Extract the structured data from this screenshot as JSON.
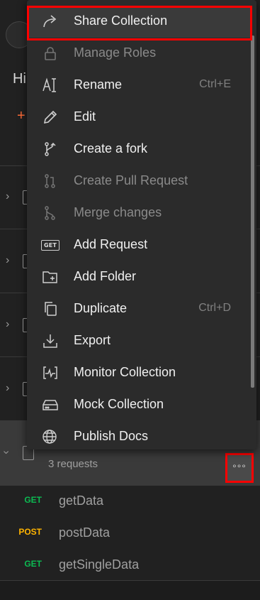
{
  "menu": {
    "items": [
      {
        "label": "Share Collection",
        "icon": "share-icon",
        "shortcut": "",
        "disabled": false,
        "highlighted": true
      },
      {
        "label": "Manage Roles",
        "icon": "lock-icon",
        "shortcut": "",
        "disabled": true
      },
      {
        "label": "Rename",
        "icon": "rename-icon",
        "shortcut": "Ctrl+E",
        "disabled": false
      },
      {
        "label": "Edit",
        "icon": "pencil-icon",
        "shortcut": "",
        "disabled": false
      },
      {
        "label": "Create a fork",
        "icon": "fork-icon",
        "shortcut": "",
        "disabled": false
      },
      {
        "label": "Create Pull Request",
        "icon": "pull-request-icon",
        "shortcut": "",
        "disabled": true
      },
      {
        "label": "Merge changes",
        "icon": "merge-icon",
        "shortcut": "",
        "disabled": true
      },
      {
        "label": "Add Request",
        "icon": "get-badge-icon",
        "shortcut": "",
        "disabled": false
      },
      {
        "label": "Add Folder",
        "icon": "add-folder-icon",
        "shortcut": "",
        "disabled": false
      },
      {
        "label": "Duplicate",
        "icon": "duplicate-icon",
        "shortcut": "Ctrl+D",
        "disabled": false
      },
      {
        "label": "Export",
        "icon": "export-icon",
        "shortcut": "",
        "disabled": false
      },
      {
        "label": "Monitor Collection",
        "icon": "monitor-icon",
        "shortcut": "",
        "disabled": false
      },
      {
        "label": "Mock Collection",
        "icon": "mock-server-icon",
        "shortcut": "",
        "disabled": false
      },
      {
        "label": "Publish Docs",
        "icon": "globe-icon",
        "shortcut": "",
        "disabled": false
      }
    ],
    "get_badge_text": "GET"
  },
  "sidebar": {
    "partial_title": "Hi",
    "new_plus": "+",
    "selected_collection": {
      "meta": "3 requests",
      "more_label": "°°°"
    },
    "requests": [
      {
        "method": "GET",
        "name": "getData"
      },
      {
        "method": "POST",
        "name": "postData"
      },
      {
        "method": "GET",
        "name": "getSingleData"
      }
    ]
  },
  "colors": {
    "highlight_border": "#ff0000",
    "get": "#0cbb52",
    "post": "#ffb400",
    "accent": "#ff6c37"
  }
}
